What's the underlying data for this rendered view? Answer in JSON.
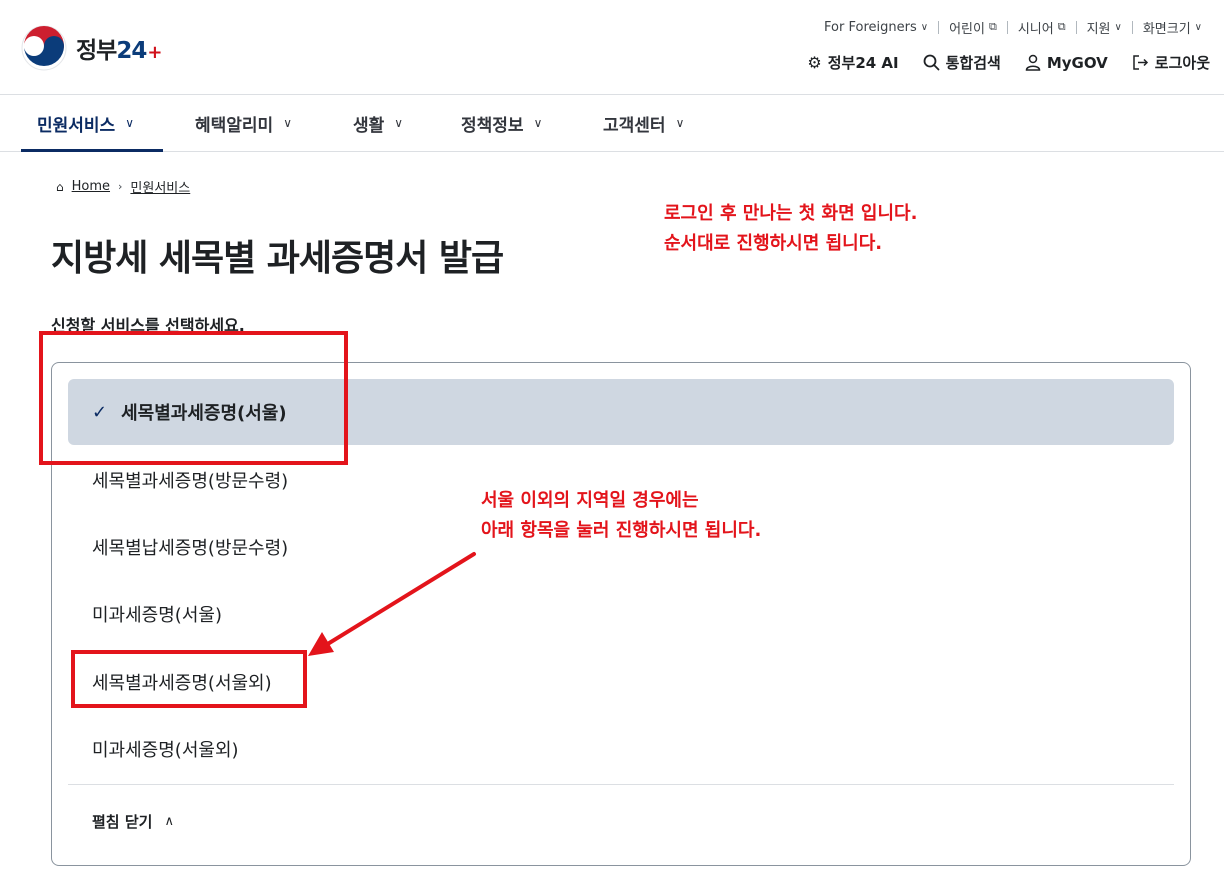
{
  "header": {
    "logo": {
      "text_main": "정부",
      "text_num": "24",
      "text_plus": "+"
    },
    "util_menu": [
      {
        "label": "For Foreigners",
        "icon": "chevron-down-icon"
      },
      {
        "label": "어린이",
        "icon": "external-link-icon"
      },
      {
        "label": "시니어",
        "icon": "external-link-icon"
      },
      {
        "label": "지원",
        "icon": "chevron-down-icon"
      },
      {
        "label": "화면크기",
        "icon": "chevron-down-icon"
      }
    ],
    "main_menu": [
      {
        "label": "정부24 AI",
        "icon": "ai-robot-icon"
      },
      {
        "label": "통합검색",
        "icon": "search-icon"
      },
      {
        "label": "MyGOV",
        "icon": "user-icon"
      },
      {
        "label": "로그아웃",
        "icon": "logout-icon"
      }
    ]
  },
  "gnb": {
    "items": [
      {
        "label": "민원서비스",
        "active": true
      },
      {
        "label": "혜택알리미",
        "active": false
      },
      {
        "label": "생활",
        "active": false
      },
      {
        "label": "정책정보",
        "active": false
      },
      {
        "label": "고객센터",
        "active": false
      }
    ]
  },
  "breadcrumb": {
    "home": "Home",
    "current": "민원서비스"
  },
  "page": {
    "title": "지방세 세목별 과세증명서 발급",
    "instruction": "신청할 서비스를 선택하세요."
  },
  "service_list": {
    "options": [
      {
        "label": "세목별과세증명(서울)",
        "selected": true
      },
      {
        "label": "세목별과세증명(방문수령)",
        "selected": false
      },
      {
        "label": "세목별납세증명(방문수령)",
        "selected": false
      },
      {
        "label": "미과세증명(서울)",
        "selected": false
      },
      {
        "label": "세목별과세증명(서울외)",
        "selected": false
      },
      {
        "label": "미과세증명(서울외)",
        "selected": false
      }
    ],
    "collapse_label": "펼침 닫기"
  },
  "annotations": {
    "note_1": [
      "로그인 후 만나는 첫 화면 입니다.",
      "순서대로 진행하시면 됩니다."
    ],
    "note_2": [
      "서울 이외의 지역일 경우에는",
      "아래 항목을 눌러 진행하시면 됩니다."
    ],
    "color": "#e3141b"
  },
  "colors": {
    "brand_navy": "#0b2b63",
    "selected_bg": "#cfd7e1",
    "annotation_red": "#e3141b"
  }
}
